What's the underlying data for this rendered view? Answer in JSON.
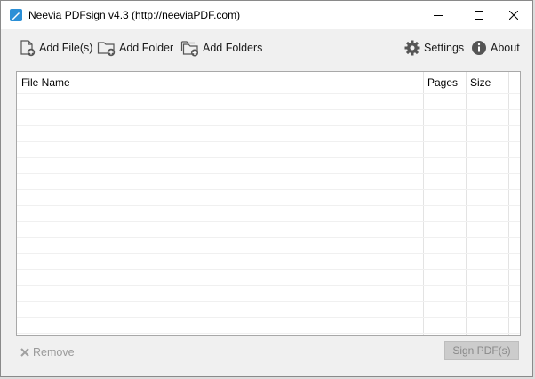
{
  "window": {
    "title": "Neevia PDFsign v4.3 (http://neeviaPDF.com)",
    "controls": {
      "minimize": "minimize",
      "maximize": "maximize",
      "close": "close"
    }
  },
  "toolbar": {
    "add_files": "Add File(s)",
    "add_folder": "Add Folder",
    "add_folders": "Add Folders",
    "settings": "Settings",
    "about": "About"
  },
  "table": {
    "columns": [
      "File Name",
      "Pages",
      "Size"
    ],
    "rows": []
  },
  "footer": {
    "remove": "Remove",
    "sign": "Sign PDF(s)"
  },
  "colors": {
    "accent": "#2b8fd6",
    "disabled_text": "#8a8a8a",
    "button_disabled_bg": "#cccccc"
  },
  "icons": {
    "app": "pen-icon",
    "add_files": "file-add-icon",
    "add_folder": "folder-add-icon",
    "add_folders": "folders-add-icon",
    "settings": "gear-icon",
    "about": "info-icon",
    "remove": "x-icon"
  }
}
